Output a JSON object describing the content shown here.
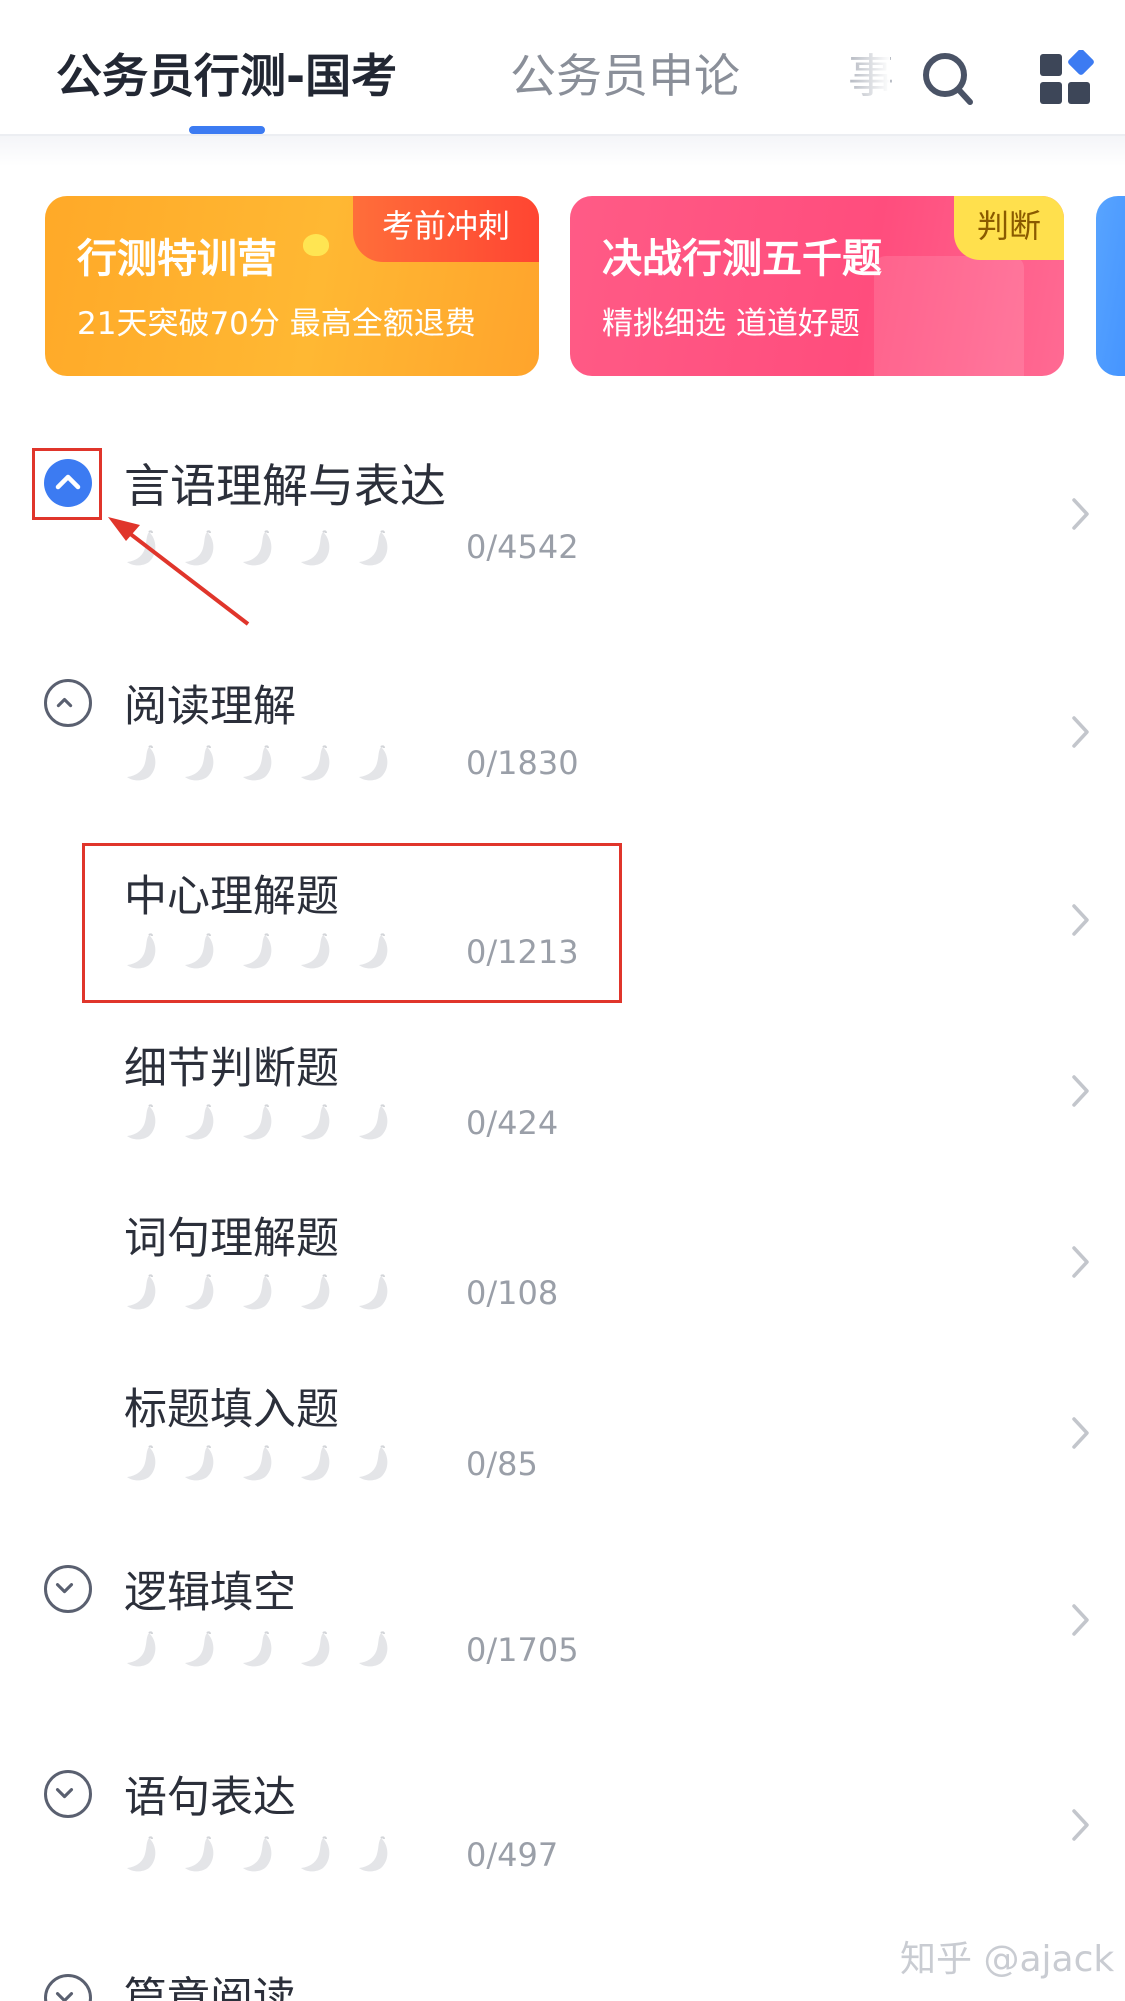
{
  "tabs": [
    "公务员行测-国考",
    "公务员申论",
    "事"
  ],
  "banners": [
    {
      "title": "行测特训营",
      "subtitle": "21天突破70分 最高全额退费",
      "tag": "考前冲刺"
    },
    {
      "title": "决战行测五千题",
      "subtitle": "精挑细选 道道好题",
      "tag": "判断"
    }
  ],
  "categories": [
    {
      "title": "言语理解与表达",
      "count": "0/4542",
      "state": "expanded",
      "level": 0
    },
    {
      "title": "阅读理解",
      "count": "0/1830",
      "state": "expanded",
      "level": 1
    },
    {
      "title": "中心理解题",
      "count": "0/1213",
      "state": "leaf",
      "level": 2
    },
    {
      "title": "细节判断题",
      "count": "0/424",
      "state": "leaf",
      "level": 2
    },
    {
      "title": "词句理解题",
      "count": "0/108",
      "state": "leaf",
      "level": 2
    },
    {
      "title": "标题填入题",
      "count": "0/85",
      "state": "leaf",
      "level": 2
    },
    {
      "title": "逻辑填空",
      "count": "0/1705",
      "state": "collapsed",
      "level": 1
    },
    {
      "title": "语句表达",
      "count": "0/497",
      "state": "collapsed",
      "level": 1
    },
    {
      "title": "篇章阅读",
      "count": "",
      "state": "collapsed",
      "level": 1
    }
  ],
  "watermark": "知乎 @ajack",
  "colors": {
    "accent": "#3c7bf2",
    "annotation": "#e0352b",
    "banner1": "#ffa928",
    "banner2": "#ff4d7d"
  },
  "icons": {
    "search": "search-icon",
    "apps": "apps-grid-icon",
    "toggle": "chevron-toggle-icon",
    "row": "chevron-right-icon",
    "progress": "banana-icon"
  }
}
